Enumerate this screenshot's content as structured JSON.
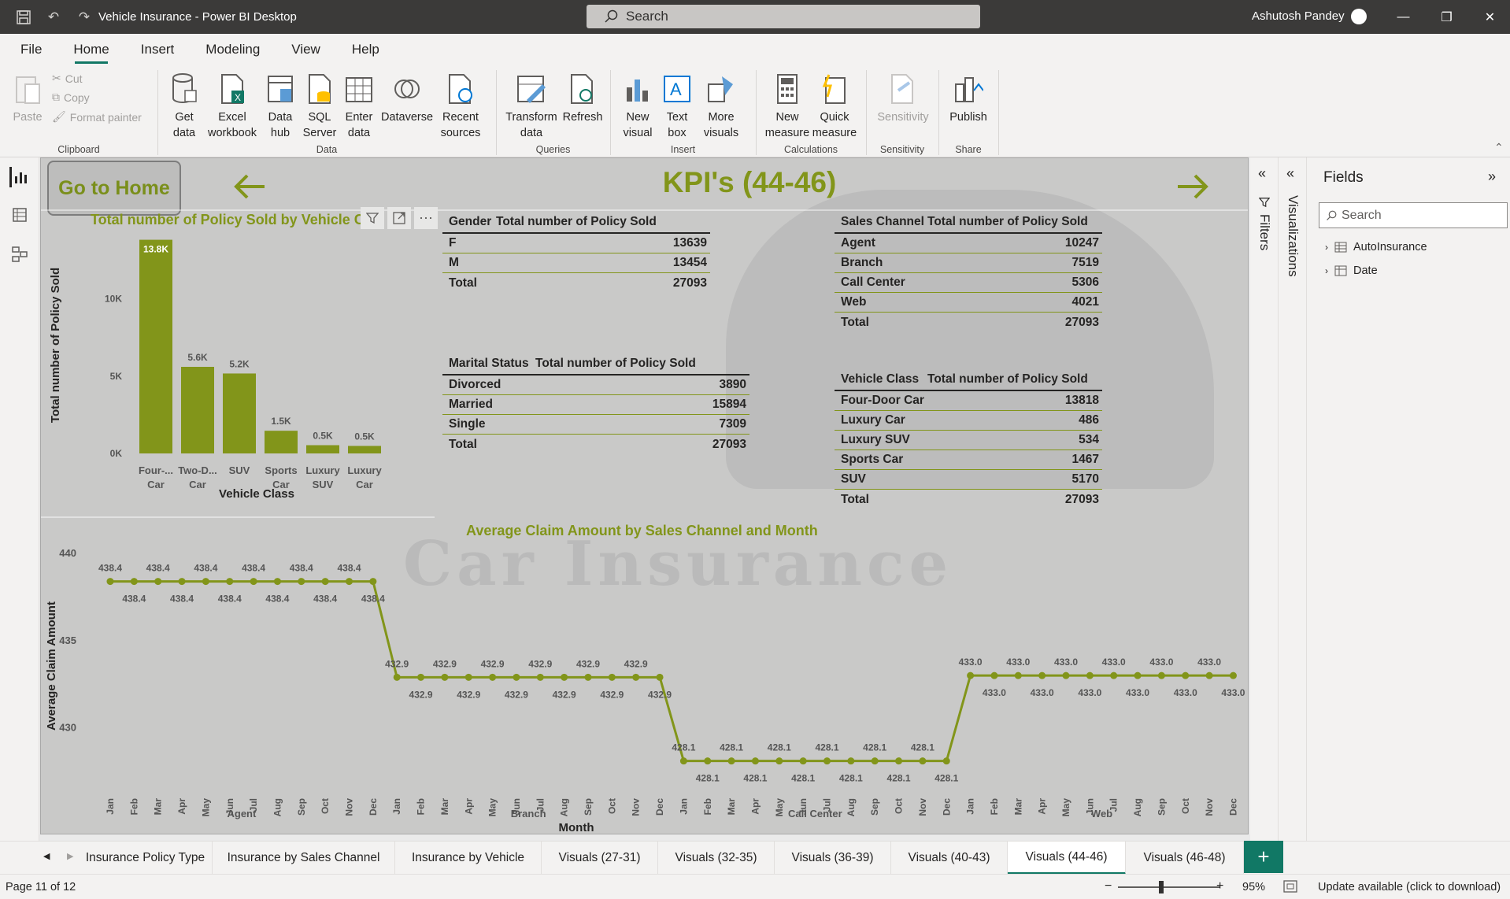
{
  "window": {
    "title": "Vehicle Insurance - Power BI Desktop",
    "search_placeholder": "Search",
    "user": "Ashutosh Pandey"
  },
  "menu": [
    "File",
    "Home",
    "Insert",
    "Modeling",
    "View",
    "Help"
  ],
  "ribbon": {
    "paste": "Paste",
    "cut": "Cut",
    "copy": "Copy",
    "format_painter": "Format painter",
    "get_data": "Get data",
    "excel": "Excel workbook",
    "data_hub": "Data hub",
    "sql": "SQL Server",
    "enter_data": "Enter data",
    "dataverse": "Dataverse",
    "recent": "Recent sources",
    "transform": "Transform data",
    "refresh": "Refresh",
    "new_visual": "New visual",
    "text_box": "Text box",
    "more_visuals": "More visuals",
    "new_measure": "New measure",
    "quick_measure": "Quick measure",
    "sensitivity": "Sensitivity",
    "publish": "Publish",
    "groups": {
      "clipboard": "Clipboard",
      "data": "Data",
      "queries": "Queries",
      "insert": "Insert",
      "calculations": "Calculations",
      "sensitivity": "Sensitivity",
      "share": "Share"
    }
  },
  "report": {
    "home_button": "Go to Home",
    "page_title": "KPI's (44-46)",
    "bar_chart_title": "Total number of Policy Sold by Vehicle C",
    "line_chart_title": "Average Claim Amount by Sales Channel and Month",
    "watermark": "Car Insurance"
  },
  "tables": {
    "gender": {
      "headers": [
        "Gender",
        "Total number of Policy Sold"
      ],
      "rows": [
        [
          "F",
          "13639"
        ],
        [
          "M",
          "13454"
        ],
        [
          "Total",
          "27093"
        ]
      ]
    },
    "marital": {
      "headers": [
        "Marital Status",
        "Total number of Policy Sold"
      ],
      "rows": [
        [
          "Divorced",
          "3890"
        ],
        [
          "Married",
          "15894"
        ],
        [
          "Single",
          "7309"
        ],
        [
          "Total",
          "27093"
        ]
      ]
    },
    "channel": {
      "headers": [
        "Sales Channel",
        "Total number of Policy Sold"
      ],
      "rows": [
        [
          "Agent",
          "10247"
        ],
        [
          "Branch",
          "7519"
        ],
        [
          "Call Center",
          "5306"
        ],
        [
          "Web",
          "4021"
        ],
        [
          "Total",
          "27093"
        ]
      ]
    },
    "vehicle": {
      "headers": [
        "Vehicle Class",
        "Total number of Policy Sold"
      ],
      "rows": [
        [
          "Four-Door Car",
          "13818"
        ],
        [
          "Luxury Car",
          "486"
        ],
        [
          "Luxury SUV",
          "534"
        ],
        [
          "Sports Car",
          "1467"
        ],
        [
          "SUV",
          "5170"
        ],
        [
          "Total",
          "27093"
        ]
      ]
    }
  },
  "chart_data": [
    {
      "type": "bar",
      "title": "Total number of Policy Sold by Vehicle C",
      "xlabel": "Vehicle Class",
      "ylabel": "Total number of Policy Sold",
      "categories": [
        "Four-... Car",
        "Two-D... Car",
        "SUV",
        "Sports Car",
        "Luxury SUV",
        "Luxury Car"
      ],
      "values": [
        13818,
        5600,
        5170,
        1467,
        534,
        486
      ],
      "data_labels": [
        "13.8K",
        "5.6K",
        "5.2K",
        "1.5K",
        "0.5K",
        "0.5K"
      ],
      "yticks": [
        "0K",
        "5K",
        "10K"
      ],
      "ylim": [
        0,
        14000
      ],
      "color": "#82951a"
    },
    {
      "type": "line",
      "title": "Average Claim Amount by Sales Channel and Month",
      "xlabel": "Month",
      "ylabel": "Average Claim Amount",
      "groups": [
        "Agent",
        "Branch",
        "Call Center",
        "Web"
      ],
      "months": [
        "Jan",
        "Feb",
        "Mar",
        "Apr",
        "May",
        "Jun",
        "Jul",
        "Aug",
        "Sep",
        "Oct",
        "Nov",
        "Dec"
      ],
      "values": [
        438.4,
        438.4,
        432.9,
        428.1,
        433.0
      ],
      "group_values": [
        438.4,
        432.9,
        428.1,
        433.0
      ],
      "yticks": [
        430,
        435,
        440
      ],
      "ylim": [
        427,
        441
      ],
      "color": "#82951a"
    }
  ],
  "fields": {
    "title": "Fields",
    "search": "Search",
    "items": [
      "AutoInsurance",
      "Date"
    ]
  },
  "side_tabs": {
    "filters": "Filters",
    "visualizations": "Visualizations"
  },
  "tabs": [
    "Insurance Policy Type",
    "Insurance by Sales Channel",
    "Insurance by Vehicle",
    "Visuals (27-31)",
    "Visuals (32-35)",
    "Visuals (36-39)",
    "Visuals (40-43)",
    "Visuals (44-46)",
    "Visuals (46-48)"
  ],
  "status": {
    "page": "Page 11 of 12",
    "zoom": "95%",
    "update": "Update available (click to download)"
  }
}
